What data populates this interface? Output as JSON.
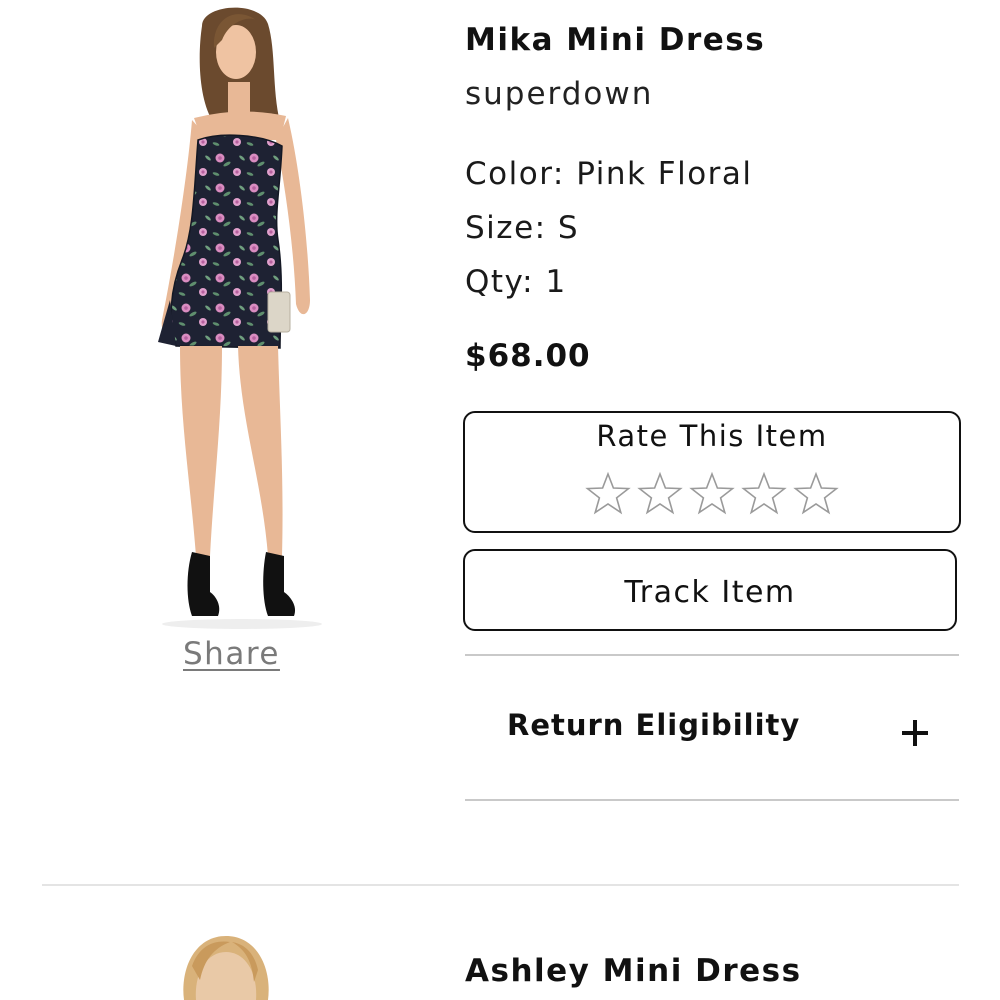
{
  "items": [
    {
      "name": "Mika Mini Dress",
      "brand": "superdown",
      "color_text": "Color: Pink Floral",
      "size_text": "Size: S",
      "qty_text": "Qty: 1",
      "price": "$68.00",
      "image_icon": "product-photo-model-floral-mini-dress",
      "share_label": "Share",
      "rate": {
        "title": "Rate This Item",
        "rating": 0,
        "max": 5,
        "star_icon": "star-outline-icon"
      },
      "track_label": "Track Item",
      "return_eligibility": {
        "label": "Return Eligibility",
        "icon": "plus-icon",
        "expanded": false
      }
    },
    {
      "name": "Ashley Mini Dress",
      "image_icon": "product-photo-model-blonde"
    }
  ],
  "colors": {
    "text": "#111111",
    "muted": "#7a7a7a",
    "border": "#111111",
    "divider": "#c9c9c9",
    "star_outline": "#9a9a9a",
    "dress_dark": "#1e2233",
    "floral_pink": "#d98cc0",
    "floral_leaf": "#5f8f6e"
  }
}
